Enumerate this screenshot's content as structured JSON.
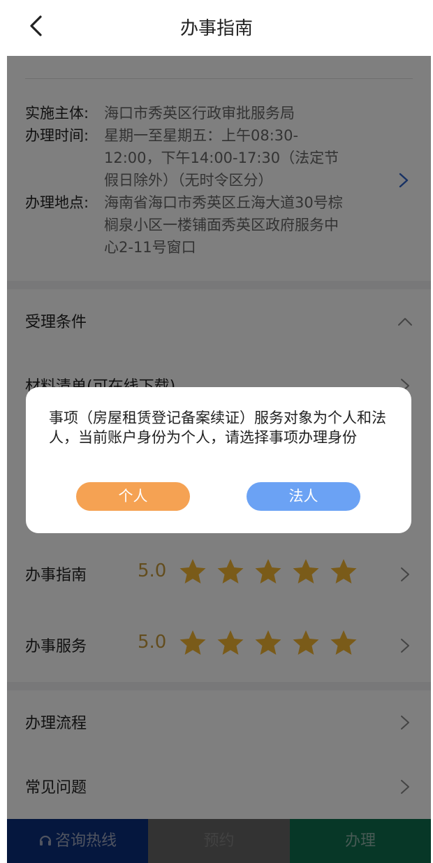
{
  "header": {
    "title": "办事指南",
    "back_icon": "chevron-left-icon"
  },
  "info": {
    "rows": [
      {
        "key": "实施主体:",
        "value": "海口市秀英区行政审批服务局"
      },
      {
        "key": "办理时间:",
        "value": "星期一至星期五：上午08:30-12:00，下午14:00-17:30（法定节假日除外）（无时令区分）"
      },
      {
        "key": "办理地点:",
        "value": "海南省海口市秀英区丘海大道30号棕榈泉小区一楼铺面秀英区政府服务中心2-11号窗口"
      }
    ],
    "arrow_icon": "chevron-right-icon",
    "arrow_color": "#2f63c8"
  },
  "sections": {
    "acceptance": "受理条件",
    "materials": "材料清单(可在线下载)",
    "guide_rating_label": "办事指南",
    "guide_rating_score": "5.0",
    "guide_rating_stars": 5,
    "service_rating_label": "办事服务",
    "service_rating_score": "5.0",
    "service_rating_stars": 5,
    "process": "办理流程",
    "faq": "常见问题"
  },
  "dialog": {
    "message": "事项（房屋租赁登记备案续证）服务对象为个人和法人，当前账户身份为个人，请选择事项办理身份",
    "personal_label": "个人",
    "legal_label": "法人"
  },
  "bottom_bar": {
    "hotline_label": "咨询热线",
    "book_label": "预约",
    "apply_label": "办理"
  },
  "colors": {
    "star": "#f5b632",
    "personal_button": "#f5a253",
    "legal_button": "#6ba2f4",
    "hotline_bg": "#1a4fb4",
    "apply_bg": "#1d9c6e"
  }
}
